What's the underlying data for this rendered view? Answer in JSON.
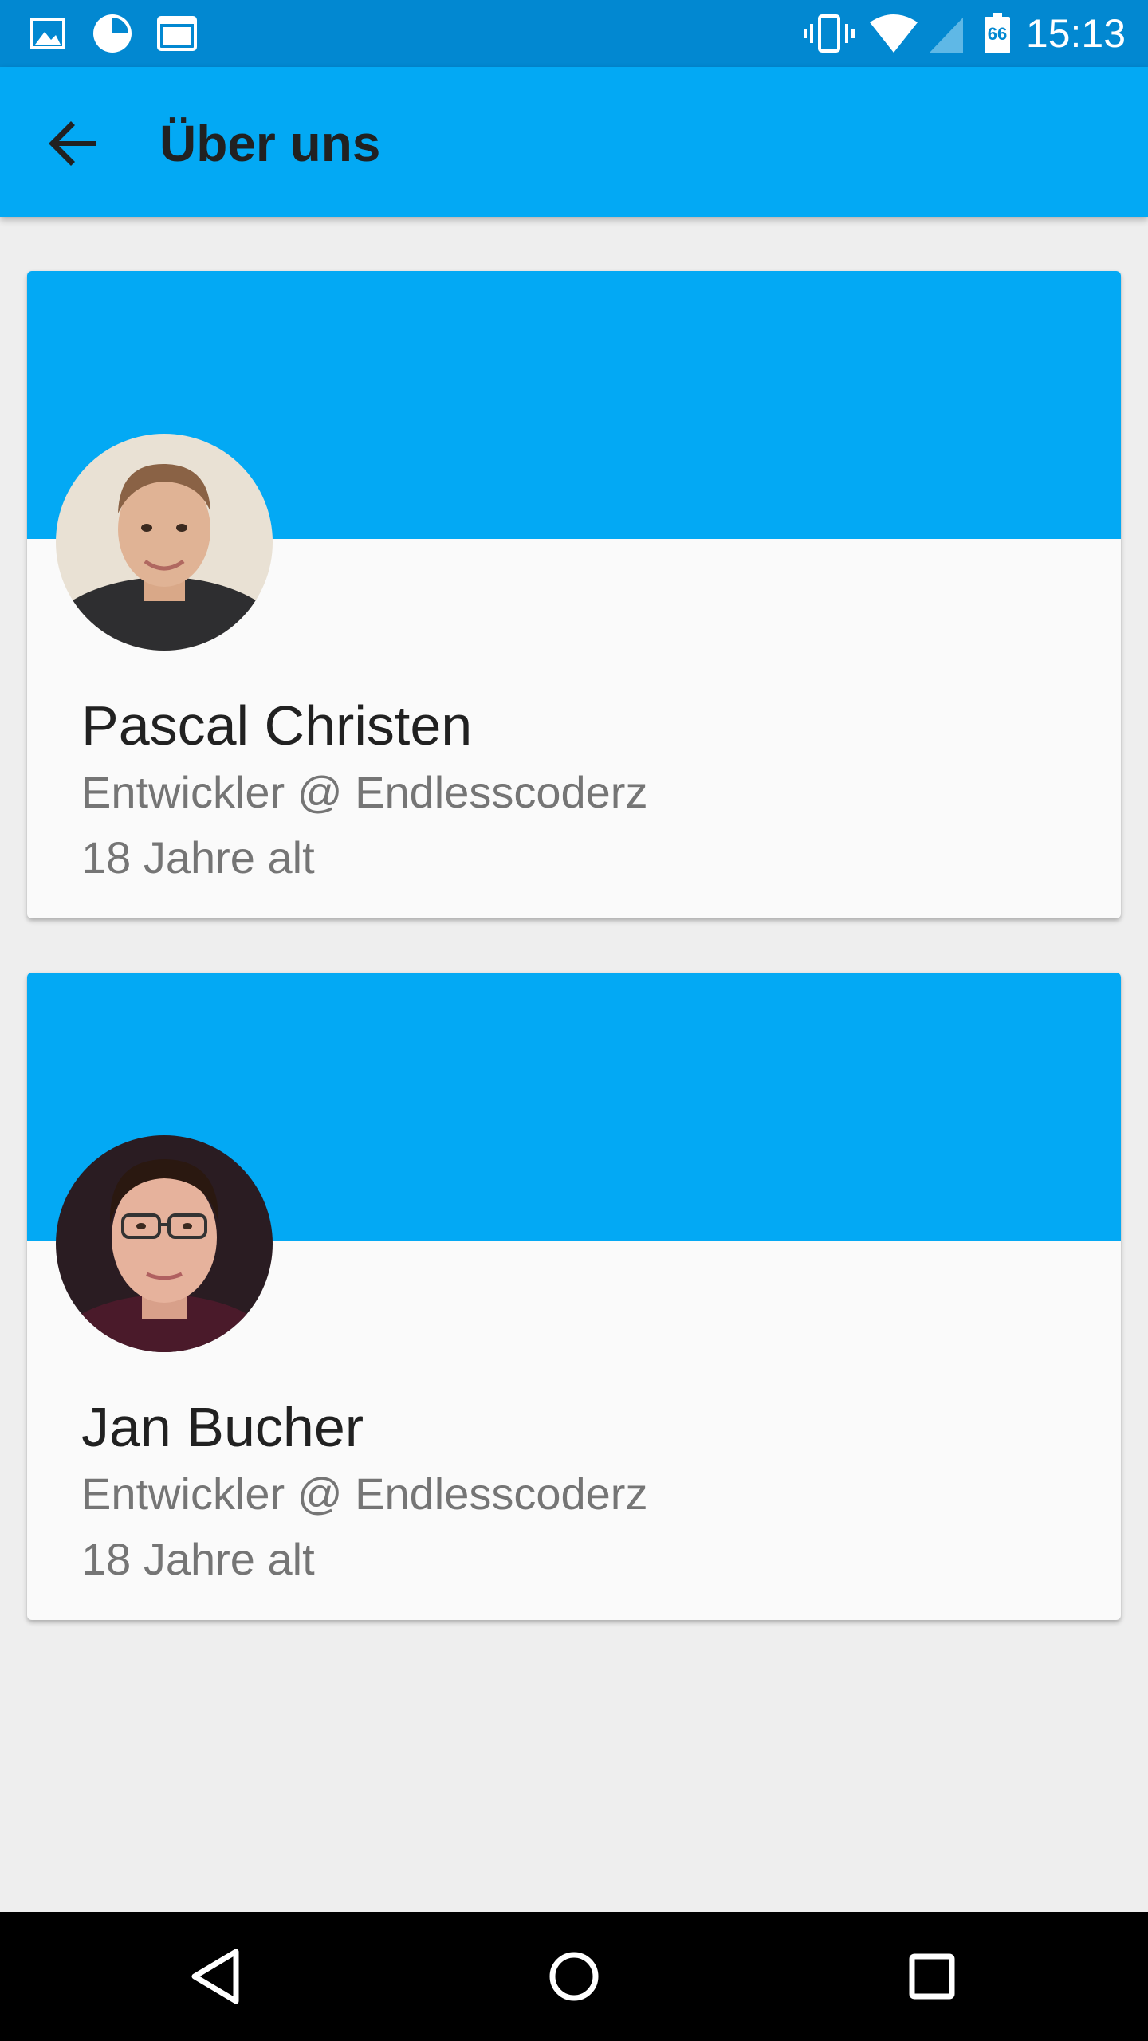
{
  "status_bar": {
    "time": "15:13",
    "battery_level": "66",
    "icons": [
      "image-notification-icon",
      "clock-notification-icon",
      "terminal-notification-icon",
      "vibrate-icon",
      "wifi-icon",
      "cell-signal-icon",
      "battery-icon"
    ]
  },
  "app_bar": {
    "title": "Über uns",
    "back_icon": "arrow-back-icon"
  },
  "team": [
    {
      "name": "Pascal Christen",
      "role": "Entwickler @ Endlesscoderz",
      "age": "18 Jahre alt"
    },
    {
      "name": "Jan Bucher",
      "role": "Entwickler @ Endlesscoderz",
      "age": "18 Jahre alt"
    }
  ],
  "nav_bar": {
    "icons": [
      "nav-back-icon",
      "nav-home-icon",
      "nav-recents-icon"
    ]
  },
  "colors": {
    "status_bar": "#0288d1",
    "primary": "#03a9f4",
    "background": "#eeeeee",
    "card": "#fafafa"
  }
}
